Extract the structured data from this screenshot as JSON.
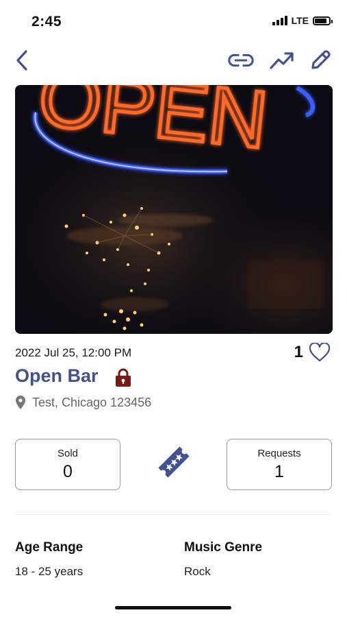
{
  "status_bar": {
    "time": "2:45",
    "network": "LTE"
  },
  "nav": {
    "back_icon": "chevron-left-icon",
    "actions": [
      "link-icon",
      "trending-up-icon",
      "edit-pencil-icon"
    ],
    "icon_color": "#44518f"
  },
  "hero": {
    "sign_text": "OPEN",
    "alt": "Neon OPEN sign in a bar"
  },
  "event": {
    "datetime": "2022 Jul 25, 12:00 PM",
    "likes": "1",
    "title": "Open Bar",
    "lock_color": "#7a1a14",
    "location": "Test, Chicago 123456"
  },
  "stats": {
    "sold_label": "Sold",
    "sold_value": "0",
    "requests_label": "Requests",
    "requests_value": "1"
  },
  "details": {
    "age_label": "Age Range",
    "age_value": "18 - 25 years",
    "genre_label": "Music Genre",
    "genre_value": "Rock"
  }
}
